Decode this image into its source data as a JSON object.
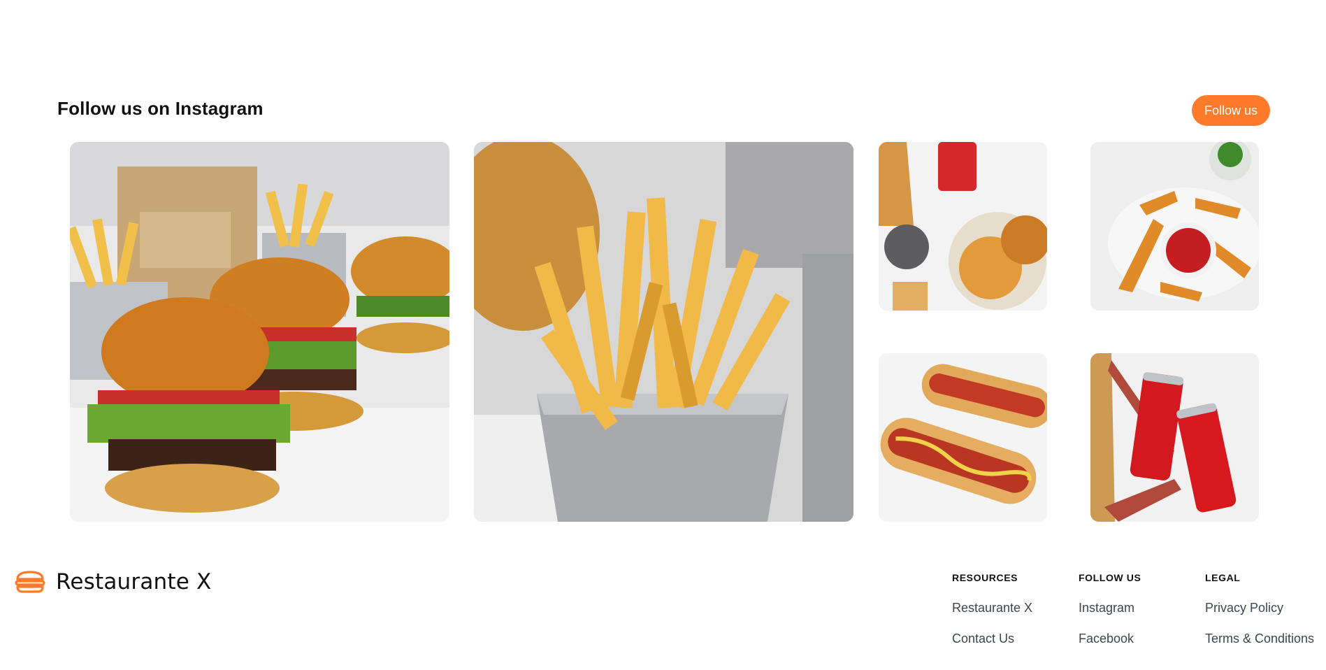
{
  "instagram": {
    "heading": "Follow us on Instagram",
    "follow_button": "Follow us"
  },
  "gallery": {
    "tiles": [
      {
        "name": "burgers-and-fries"
      },
      {
        "name": "fries-basket"
      },
      {
        "name": "burger-and-cola-flatlay"
      },
      {
        "name": "potato-wedges-with-ketchup"
      },
      {
        "name": "hot-dogs"
      },
      {
        "name": "cola-cans"
      }
    ]
  },
  "footer": {
    "brand_name": "Restaurante X",
    "accent_color": "#ff7a2a",
    "columns": [
      {
        "heading": "RESOURCES",
        "links": [
          "Restaurante X",
          "Contact Us"
        ]
      },
      {
        "heading": "FOLLOW US",
        "links": [
          "Instagram",
          "Facebook"
        ]
      },
      {
        "heading": "LEGAL",
        "links": [
          "Privacy Policy",
          "Terms & Conditions"
        ]
      }
    ]
  }
}
